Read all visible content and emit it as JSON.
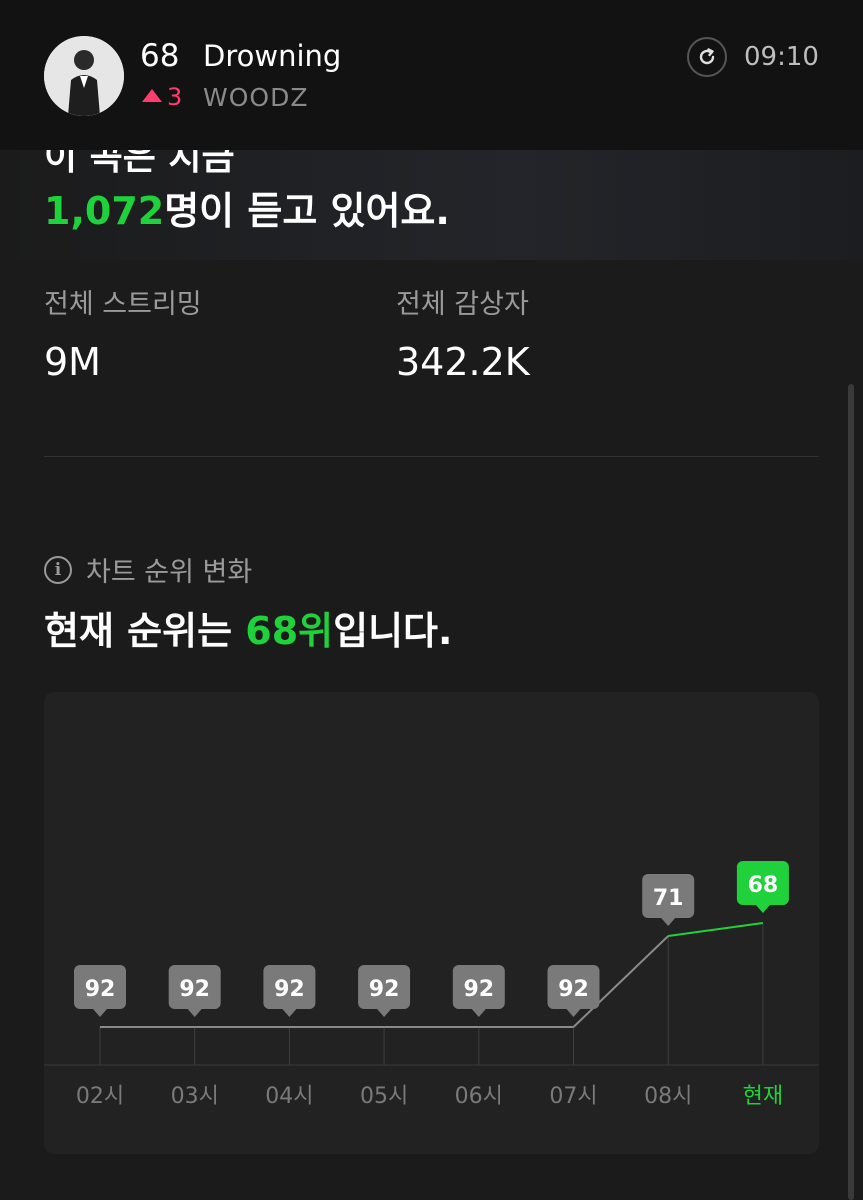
{
  "header": {
    "rank": "68",
    "title": "Drowning",
    "rank_change": "3",
    "rank_change_direction": "up",
    "artist": "WOODZ",
    "time": "09:10",
    "refresh_icon": "refresh-icon",
    "avatar_icon": "artist-avatar"
  },
  "live": {
    "partial_line": "이 곡은 지금",
    "listeners_count": "1,072",
    "listeners_suffix": "명이 듣고 있어요."
  },
  "stats": {
    "streaming_label": "전체 스트리밍",
    "streaming_value": "9M",
    "listeners_label": "전체 감상자",
    "listeners_value": "342.2K"
  },
  "chart_section": {
    "label": "차트 순위 변화",
    "headline_prefix": "현재 순위는 ",
    "headline_rank": "68위",
    "headline_suffix": "입니다."
  },
  "colors": {
    "accent": "#1fd23b",
    "up": "#ff3c6e",
    "grey_badge": "#7a7a7a"
  },
  "chart_data": {
    "type": "line",
    "categories": [
      "02시",
      "03시",
      "04시",
      "05시",
      "06시",
      "07시",
      "08시",
      "현재"
    ],
    "values": [
      92,
      92,
      92,
      92,
      92,
      92,
      71,
      68
    ],
    "highlight_index": 7,
    "y_reversed": true
  }
}
